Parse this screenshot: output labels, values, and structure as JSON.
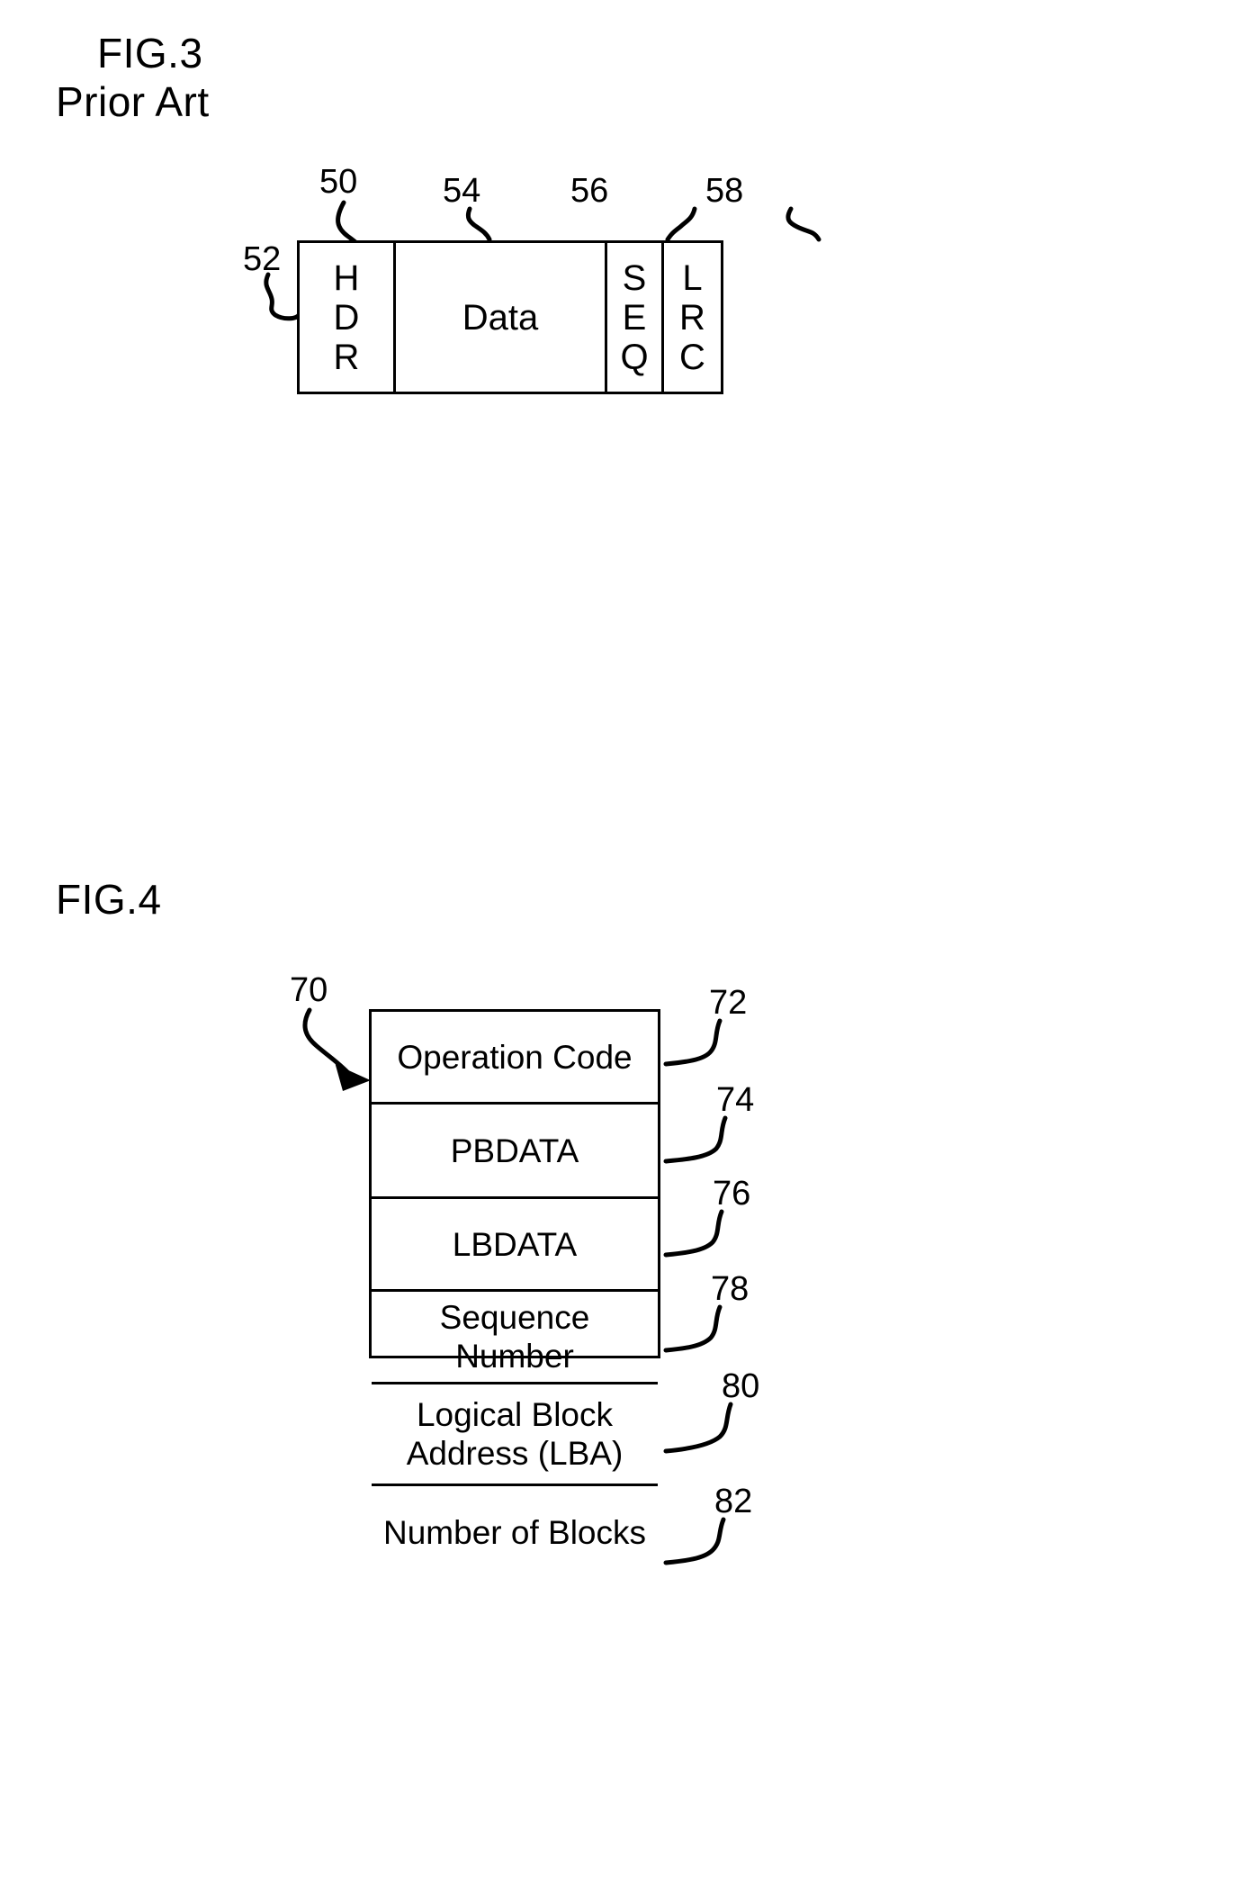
{
  "figures": {
    "fig3": {
      "title": "FIG.3",
      "subtitle": "Prior Art",
      "packet": {
        "ref_overall": "50",
        "cells": [
          {
            "label": "HDR",
            "orientation": "vertical",
            "letters": [
              "H",
              "D",
              "R"
            ],
            "ref": "52"
          },
          {
            "label": "Data",
            "orientation": "horizontal",
            "letters": [
              "Data"
            ],
            "ref": "54"
          },
          {
            "label": "SEQ",
            "orientation": "vertical",
            "letters": [
              "S",
              "E",
              "Q"
            ],
            "ref": "56"
          },
          {
            "label": "LRC",
            "orientation": "vertical",
            "letters": [
              "L",
              "R",
              "C"
            ],
            "ref": "58"
          }
        ]
      }
    },
    "fig4": {
      "title": "FIG.4",
      "table": {
        "ref_overall": "70",
        "rows": [
          {
            "label": "Operation Code",
            "ref": "72"
          },
          {
            "label": "PBDATA",
            "ref": "74"
          },
          {
            "label": "LBDATA",
            "ref": "76"
          },
          {
            "label": "Sequence Number",
            "ref": "78"
          },
          {
            "label": "Logical Block\nAddress (LBA)",
            "ref": "80"
          },
          {
            "label": "Number of Blocks",
            "ref": "82"
          }
        ]
      }
    }
  },
  "colors": {
    "ink": "#000000",
    "paper": "#ffffff"
  }
}
